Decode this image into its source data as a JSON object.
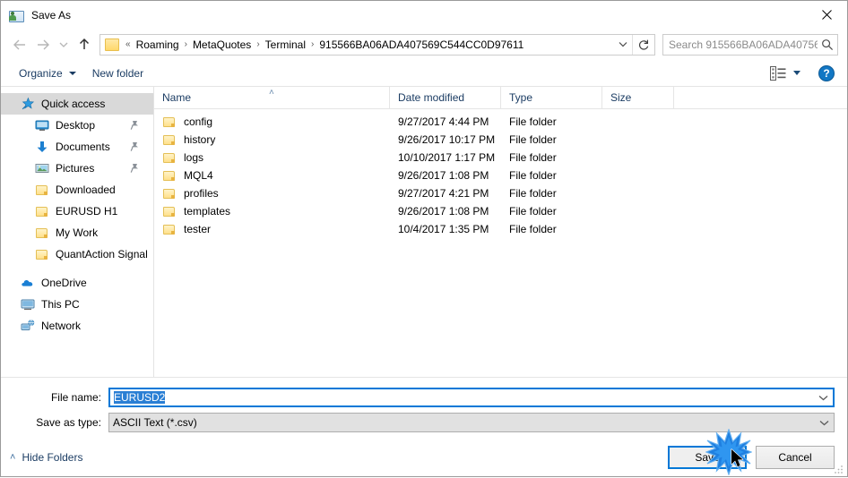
{
  "window": {
    "title": "Save As",
    "title_icon": "save-as-folder-person-icon",
    "close_icon": "close-icon"
  },
  "nav": {
    "back_icon": "arrow-left-icon",
    "forward_icon": "arrow-right-icon",
    "recent_icon": "chevron-down-icon",
    "up_icon": "arrow-up-icon",
    "refresh_icon": "refresh-icon",
    "address_chevron_icon": "chevron-down-icon"
  },
  "address": {
    "folder_icon": "folder-icon",
    "overflow": "«",
    "separator": "›",
    "crumbs": [
      "Roaming",
      "MetaQuotes",
      "Terminal",
      "915566BA06ADA407569C544CC0D97611"
    ]
  },
  "search": {
    "placeholder": "Search 915566BA06ADA40756...",
    "icon": "search-icon"
  },
  "toolbar": {
    "organize_label": "Organize",
    "new_folder_label": "New folder",
    "view_icon": "view-options-icon",
    "help_label": "?",
    "help_icon": "help-icon"
  },
  "sidebar": {
    "items": [
      {
        "label": "Quick access",
        "icon": "star-pin-icon",
        "level": 1,
        "selected": true,
        "pinned": false
      },
      {
        "label": "Desktop",
        "icon": "desktop-icon",
        "level": 2,
        "selected": false,
        "pinned": true
      },
      {
        "label": "Documents",
        "icon": "documents-download-icon",
        "level": 2,
        "selected": false,
        "pinned": true
      },
      {
        "label": "Pictures",
        "icon": "pictures-icon",
        "level": 2,
        "selected": false,
        "pinned": true
      },
      {
        "label": "Downloaded",
        "icon": "folder-icon",
        "level": 2,
        "selected": false,
        "pinned": false
      },
      {
        "label": "EURUSD H1",
        "icon": "folder-icon",
        "level": 2,
        "selected": false,
        "pinned": false
      },
      {
        "label": "My Work",
        "icon": "folder-icon",
        "level": 2,
        "selected": false,
        "pinned": false
      },
      {
        "label": "QuantAction Signal",
        "icon": "folder-icon",
        "level": 2,
        "selected": false,
        "pinned": false
      },
      {
        "label": "OneDrive",
        "icon": "onedrive-cloud-icon",
        "level": 1,
        "selected": false,
        "pinned": false
      },
      {
        "label": "This PC",
        "icon": "this-pc-icon",
        "level": 1,
        "selected": false,
        "pinned": false
      },
      {
        "label": "Network",
        "icon": "network-icon",
        "level": 1,
        "selected": false,
        "pinned": false
      }
    ]
  },
  "filelist": {
    "columns": [
      "Name",
      "Date modified",
      "Type",
      "Size"
    ],
    "sort_caret": "˄",
    "rows": [
      {
        "name": "config",
        "date": "9/27/2017 4:44 PM",
        "type": "File folder",
        "size": ""
      },
      {
        "name": "history",
        "date": "9/26/2017 10:17 PM",
        "type": "File folder",
        "size": ""
      },
      {
        "name": "logs",
        "date": "10/10/2017 1:17 PM",
        "type": "File folder",
        "size": ""
      },
      {
        "name": "MQL4",
        "date": "9/26/2017 1:08 PM",
        "type": "File folder",
        "size": ""
      },
      {
        "name": "profiles",
        "date": "9/27/2017 4:21 PM",
        "type": "File folder",
        "size": ""
      },
      {
        "name": "templates",
        "date": "9/26/2017 1:08 PM",
        "type": "File folder",
        "size": ""
      },
      {
        "name": "tester",
        "date": "10/4/2017 1:35 PM",
        "type": "File folder",
        "size": ""
      }
    ]
  },
  "form": {
    "filename_label": "File name:",
    "filename_value": "EURUSD2",
    "filetype_label": "Save as type:",
    "filetype_value": "ASCII Text (*.csv)",
    "chevron_icon": "chevron-down-icon"
  },
  "footer": {
    "hide_folders_label": "Hide Folders",
    "hide_folders_caret": "˄",
    "save_label": "Save",
    "cancel_label": "Cancel"
  },
  "overlay": {
    "click_burst_icon": "click-burst-icon",
    "cursor_icon": "mouse-cursor-icon"
  },
  "colors": {
    "accent": "#0078d7",
    "selection": "#2a7fd4",
    "link_text": "#1b3c63",
    "folder_yellow": "#ffe08a",
    "help_blue": "#1277c4",
    "burst_blue": "#1f7fe0"
  }
}
